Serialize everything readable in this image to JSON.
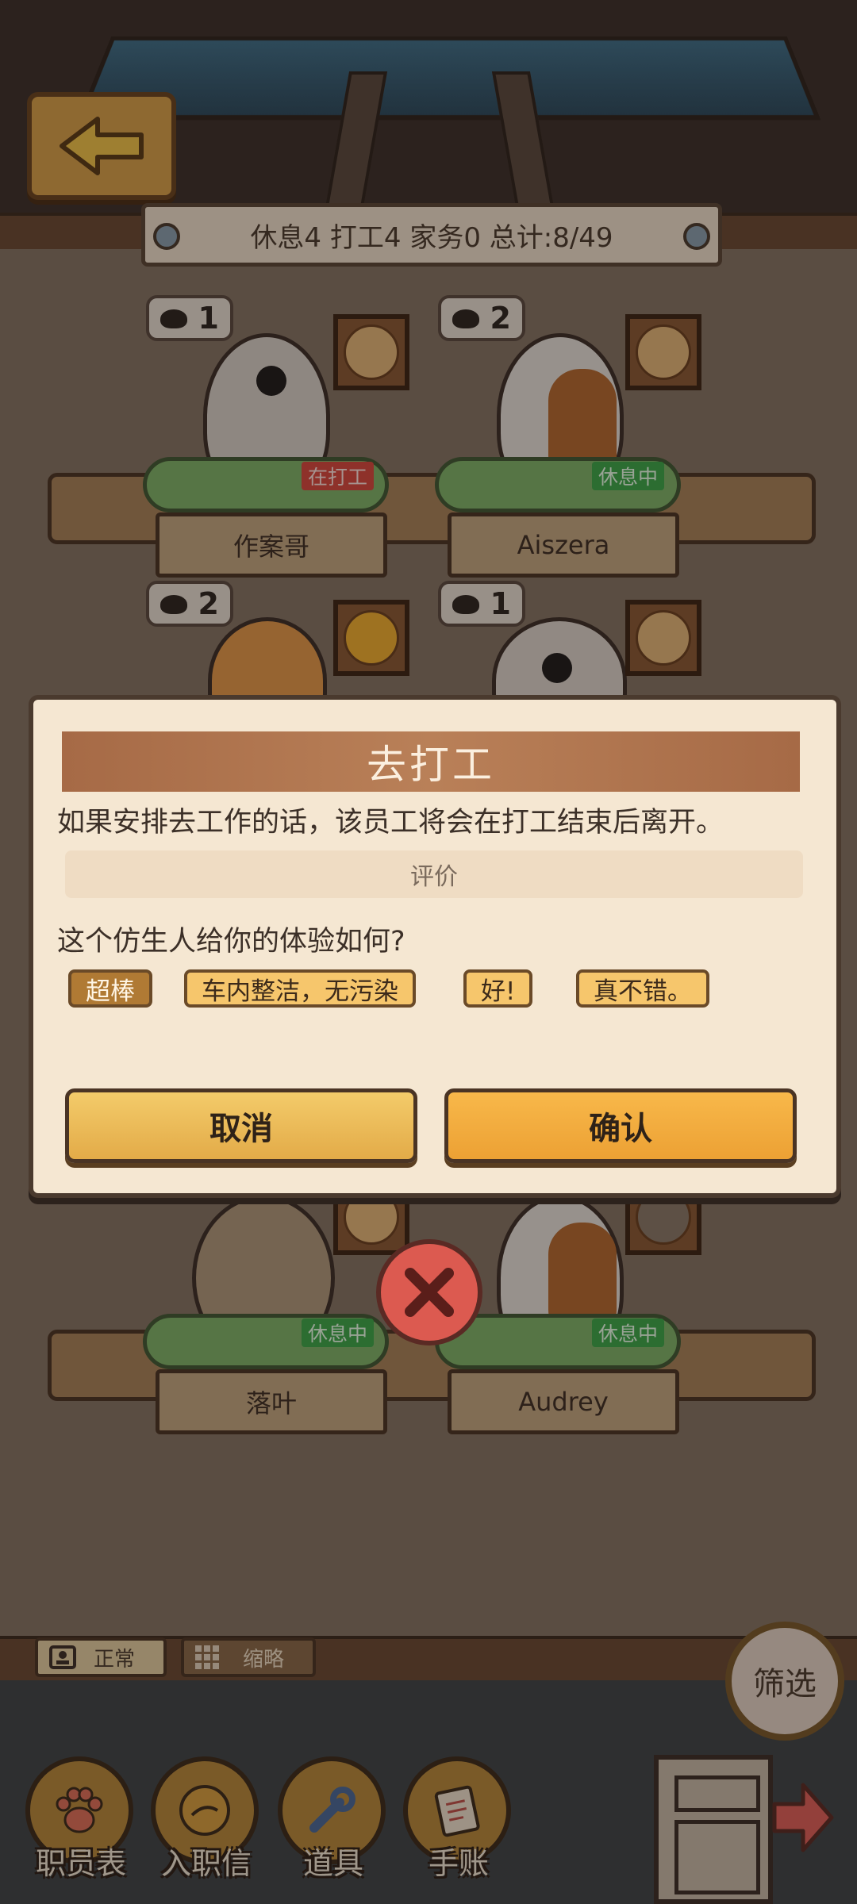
{
  "stats": {
    "text": "休息4  打工4  家务0  总计:8/49"
  },
  "employees": [
    {
      "name": "作案哥",
      "mood": "1",
      "status": "在打工"
    },
    {
      "name": "Aiszera",
      "mood": "2",
      "status": "休息中"
    },
    {
      "name": "",
      "mood": "2",
      "status": ""
    },
    {
      "name": "",
      "mood": "1",
      "status": ""
    },
    {
      "name": "落叶",
      "mood": "",
      "status": "休息中"
    },
    {
      "name": "Audrey",
      "mood": "",
      "status": "休息中"
    }
  ],
  "dialog": {
    "title": "去打工",
    "message": "如果安排去工作的话，该员工将会在打工结束后离开。",
    "rating_label": "评价",
    "question": "这个仿生人给你的体验如何?",
    "tags": [
      "超棒",
      "车内整洁，无污染",
      "好!",
      "真不错。"
    ],
    "selected_tag": "超棒",
    "cancel_label": "取消",
    "confirm_label": "确认"
  },
  "view_modes": {
    "normal_label": "正常",
    "compact_label": "缩略"
  },
  "filter_label": "筛选",
  "nav": [
    {
      "label": "职员表",
      "icon": "paw-icon"
    },
    {
      "label": "入职信",
      "icon": "coin-icon"
    },
    {
      "label": "道具",
      "icon": "wrench-icon"
    },
    {
      "label": "手账",
      "icon": "notebook-icon"
    }
  ],
  "colors": {
    "accent": "#eca134",
    "panel": "#f5e7d2",
    "title_bar": "#a66a46",
    "rest": "#3aa84a",
    "work": "#d9473e"
  }
}
